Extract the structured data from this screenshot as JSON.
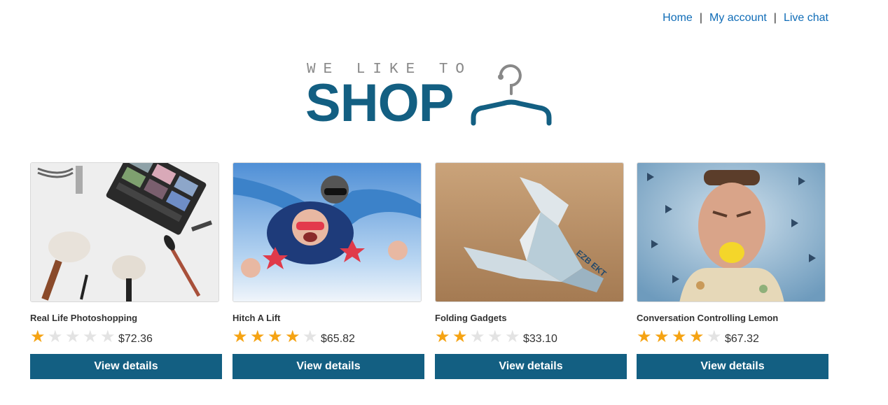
{
  "nav": {
    "home": "Home",
    "separator": "|",
    "my_account": "My account",
    "live_chat": "Live chat"
  },
  "logo": {
    "tagline": "WE LIKE TO",
    "wordmark": "SHOP",
    "icon": "coat-hanger-icon"
  },
  "colors": {
    "brand": "#135f82",
    "link": "#0f6cb7",
    "star_on": "#f5a313",
    "star_off": "#e3e3e3"
  },
  "products": [
    {
      "name": "Real Life Photoshopping",
      "rating": 1,
      "rating_max": 5,
      "price": "$72.36",
      "button": "View details",
      "image": "makeup-palette-and-brushes"
    },
    {
      "name": "Hitch A Lift",
      "rating": 4,
      "rating_max": 5,
      "price": "$65.82",
      "button": "View details",
      "image": "tandem-skydivers"
    },
    {
      "name": "Folding Gadgets",
      "rating": 2,
      "rating_max": 5,
      "price": "$33.10",
      "button": "View details",
      "image": "origami-banknote-bird"
    },
    {
      "name": "Conversation Controlling Lemon",
      "rating": 4,
      "rating_max": 5,
      "price": "$67.32",
      "button": "View details",
      "image": "man-with-lemon-in-mouth"
    }
  ]
}
